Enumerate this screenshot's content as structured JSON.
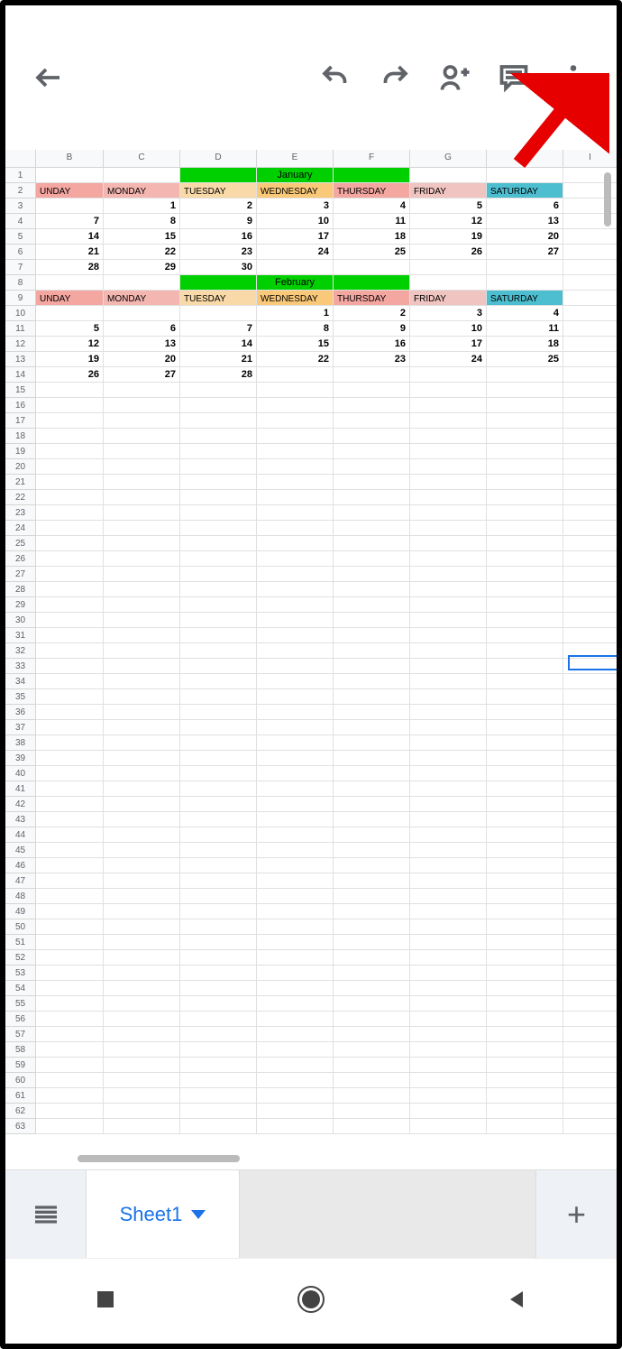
{
  "columns": [
    "B",
    "C",
    "D",
    "E",
    "F",
    "G",
    "H",
    "I"
  ],
  "months": {
    "m1": "January",
    "m2": "February"
  },
  "days": {
    "sun": "UNDAY",
    "mon": "MONDAY",
    "tue": "TUESDAY",
    "wed": "WEDNESDAY",
    "thu": "THURSDAY",
    "fri": "FRIDAY",
    "sat": "SATURDAY",
    "satp": "SATU"
  },
  "jan": {
    "r3": [
      "",
      "1",
      "2",
      "3",
      "4",
      "5",
      "6"
    ],
    "r4": [
      "7",
      "8",
      "9",
      "10",
      "11",
      "12",
      "13"
    ],
    "r5": [
      "14",
      "15",
      "16",
      "17",
      "18",
      "19",
      "20"
    ],
    "r6": [
      "21",
      "22",
      "23",
      "24",
      "25",
      "26",
      "27"
    ],
    "r7": [
      "28",
      "29",
      "30",
      "",
      "",
      "",
      ""
    ]
  },
  "feb": {
    "r10": [
      "",
      "",
      "",
      "1",
      "2",
      "3",
      "4"
    ],
    "r11": [
      "5",
      "6",
      "7",
      "8",
      "9",
      "10",
      "11"
    ],
    "r12": [
      "12",
      "13",
      "14",
      "15",
      "16",
      "17",
      "18"
    ],
    "r13": [
      "19",
      "20",
      "21",
      "22",
      "23",
      "24",
      "25"
    ],
    "r14": [
      "26",
      "27",
      "28",
      "",
      "",
      "",
      ""
    ]
  },
  "colors": {
    "sun": "#f4a6a0",
    "mon": "#f4b6b0",
    "tue": "#f9d9a8",
    "wed": "#f9c878",
    "thu": "#f4a6a0",
    "fri": "#f0c4c0",
    "sat": "#4dbecf"
  },
  "tab": {
    "name": "Sheet1"
  },
  "rows_total": 63
}
